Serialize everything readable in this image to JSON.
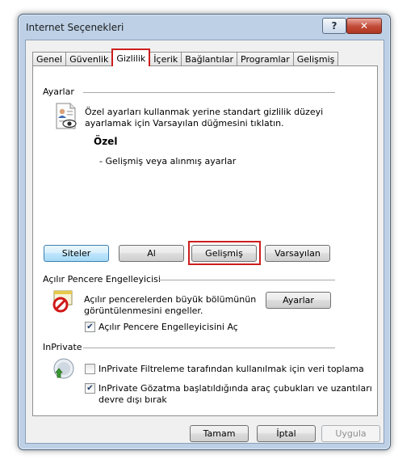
{
  "window": {
    "title": "Internet Seçenekleri"
  },
  "tabs": [
    "Genel",
    "Güvenlik",
    "Gizlilik",
    "İçerik",
    "Bağlantılar",
    "Programlar",
    "Gelişmiş"
  ],
  "active_tab": "Gizlilik",
  "settings": {
    "group_label": "Ayarlar",
    "description_line1": "Özel ayarları kullanmak yerine standart gizlilik düzeyi",
    "description_line2": "ayarlamak için Varsayılan düğmesini tıklatın.",
    "level_title": "Özel",
    "level_detail": "- Gelişmiş veya alınmış ayarlar",
    "buttons": {
      "sites": "Siteler",
      "import": "Al",
      "advanced": "Gelişmiş",
      "default": "Varsayılan"
    }
  },
  "popup_blocker": {
    "group_label": "Açılır Pencere Engelleyicisi",
    "description_line1": "Açılır pencerelerden büyük bölümünün",
    "description_line2": "görüntülenmesini engeller.",
    "settings_button": "Ayarlar",
    "enable_label": "Açılır Pencere Engelleyicisini Aç",
    "enabled": true
  },
  "inprivate": {
    "group_label": "InPrivate",
    "filter_label": "InPrivate Filtreleme tarafından kullanılmak için veri toplama",
    "filter_checked": false,
    "toolbar_label_line1": "InPrivate Gözatma başlatıldığında araç çubukları ve uzantıları",
    "toolbar_label_line2": "devre dışı bırak",
    "toolbar_checked": true
  },
  "footer": {
    "ok": "Tamam",
    "cancel": "İptal",
    "apply": "Uygula"
  },
  "icons": {
    "help": "help-icon",
    "close": "close-icon",
    "privacy": "privacy-document-icon",
    "popup": "popup-blocked-icon",
    "inprivate": "inprivate-icon"
  }
}
